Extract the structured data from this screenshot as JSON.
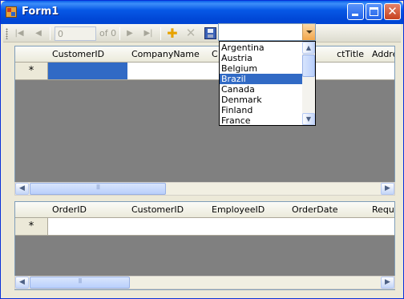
{
  "window": {
    "title": "Form1",
    "minimize_glyph": "",
    "maximize_glyph": "",
    "close_glyph": "✕"
  },
  "navigator": {
    "move_first_glyph": "|◀",
    "move_previous_glyph": "◀",
    "position_value": "0",
    "count_label": "of 0",
    "move_next_glyph": "▶",
    "move_last_glyph": "▶|",
    "add_glyph": "✚",
    "delete_glyph": "✕",
    "save_icon": "save-icon"
  },
  "country_combo": {
    "selected_value": "",
    "options": [
      "Argentina",
      "Austria",
      "Belgium",
      "Brazil",
      "Canada",
      "Denmark",
      "Finland",
      "France"
    ],
    "highlighted": "Brazil"
  },
  "customers_grid": {
    "columns": [
      "CustomerID",
      "CompanyName",
      "ContactName",
      "ContactTitle",
      "Address"
    ],
    "visible_headers": [
      "CustomerID",
      "CompanyName",
      "C",
      "ctTitle",
      "Addre"
    ],
    "new_row_marker": "*"
  },
  "orders_grid": {
    "columns": [
      "OrderID",
      "CustomerID",
      "EmployeeID",
      "OrderDate",
      "RequiredDate"
    ],
    "visible_headers": [
      "OrderID",
      "CustomerID",
      "EmployeeID",
      "OrderDate",
      "Requ"
    ],
    "new_row_marker": "*"
  },
  "scrollbars": {
    "left_arrow": "◀",
    "right_arrow": "▶",
    "up_arrow": "▲",
    "down_arrow": "▼"
  },
  "colors": {
    "title_bar": "#0458e4",
    "selection": "#316ac5",
    "grid_background": "#808080",
    "face": "#ece9d8"
  }
}
